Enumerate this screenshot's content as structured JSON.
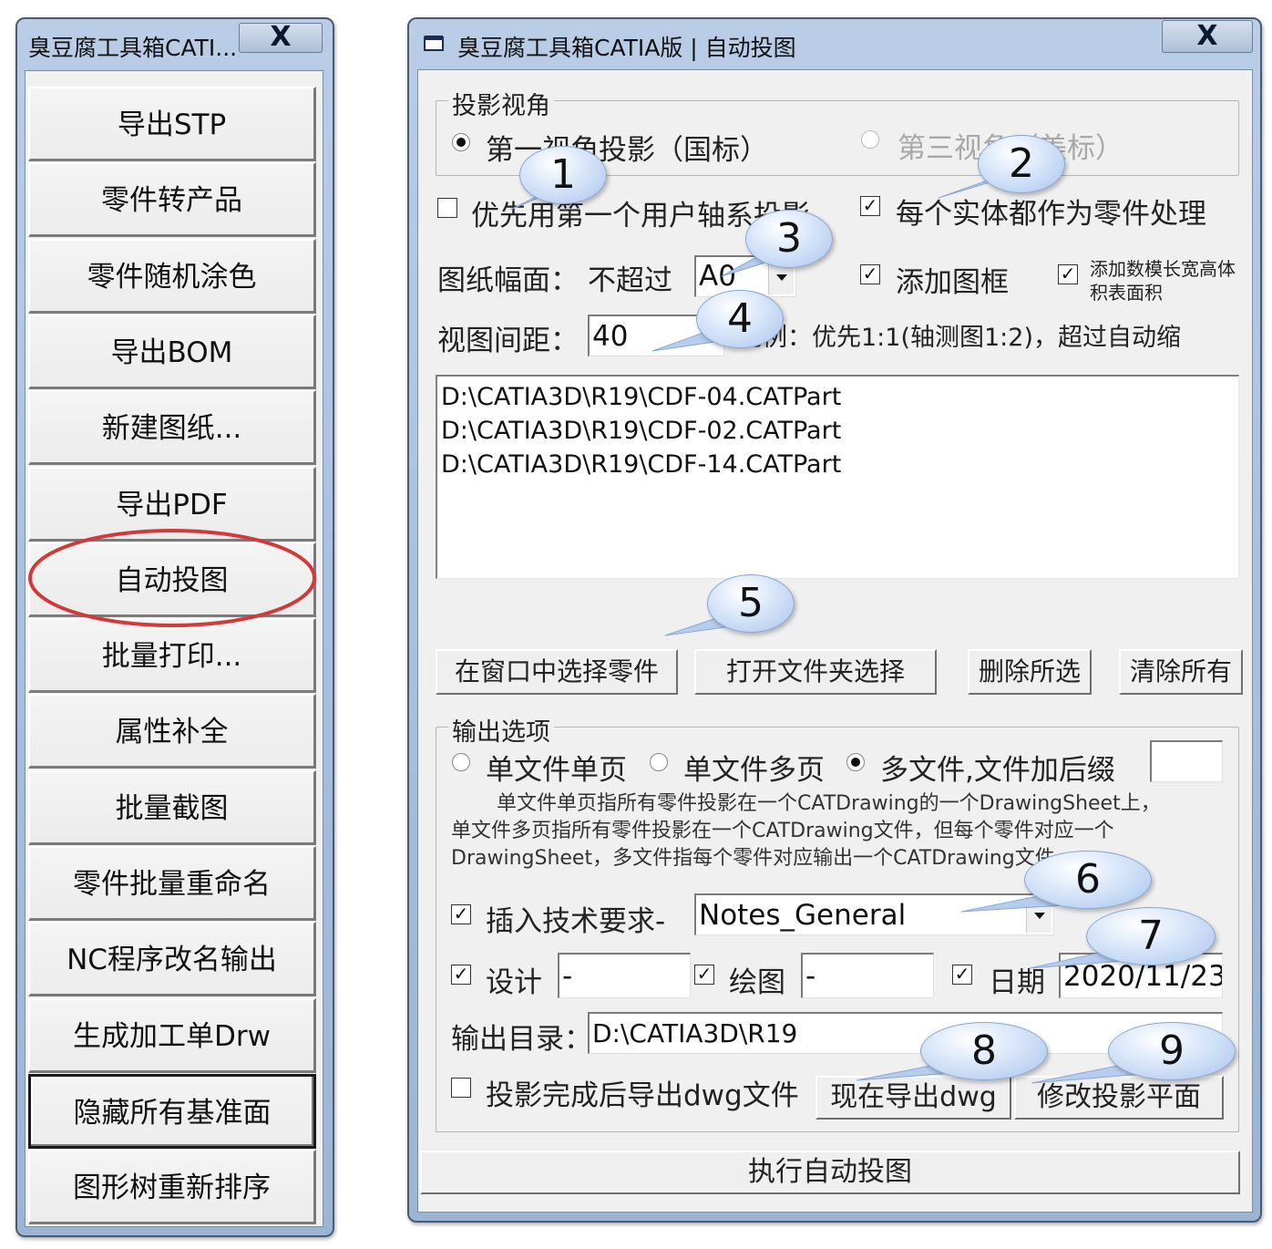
{
  "left_window": {
    "title": "臭豆腐工具箱CATI...",
    "close_label": "X",
    "buttons": [
      {
        "label": "导出STP"
      },
      {
        "label": "零件转产品"
      },
      {
        "label": "零件随机涂色"
      },
      {
        "label": "导出BOM"
      },
      {
        "label": "新建图纸..."
      },
      {
        "label": "导出PDF"
      },
      {
        "label": "自动投图",
        "highlighted": true
      },
      {
        "label": "批量打印..."
      },
      {
        "label": "属性补全"
      },
      {
        "label": "批量截图"
      },
      {
        "label": "零件批量重命名"
      },
      {
        "label": "NC程序改名输出"
      },
      {
        "label": "生成加工单Drw"
      },
      {
        "label": "隐藏所有基准面",
        "default": true
      },
      {
        "label": "图形树重新排序"
      }
    ],
    "highlight_color": "#d23a3a"
  },
  "main_window": {
    "title": "臭豆腐工具箱CATIA版 | 自动投图",
    "close_label": "X",
    "projection": {
      "group_label": "投影视角",
      "first_angle": {
        "label": "第一视角投影（国标）",
        "selected": true
      },
      "third_angle": {
        "label": "第三视角（美标）",
        "selected": false,
        "disabled": true
      }
    },
    "options": {
      "use_first_axis": {
        "label": "优先用第一个用户轴系投影",
        "checked": false
      },
      "each_body_as_part": {
        "label": "每个实体都作为零件处理",
        "checked": true
      }
    },
    "paper": {
      "label": "图纸幅面：",
      "not_exceed": "不超过",
      "size_value": "A0",
      "add_frame": {
        "label": "添加图框",
        "checked": true
      },
      "add_dims": {
        "label_line1": "添加数模长宽高体",
        "label_line2": "积表面积",
        "checked": true
      }
    },
    "spacing": {
      "label": "视图间距：",
      "value": "40",
      "scale_text": "比例：优先1:1(轴测图1:2)，超过自动缩"
    },
    "files": [
      "D:\\CATIA3D\\R19\\CDF-04.CATPart",
      "D:\\CATIA3D\\R19\\CDF-02.CATPart",
      "D:\\CATIA3D\\R19\\CDF-14.CATPart"
    ],
    "file_buttons": {
      "select_in_window": "在窗口中选择零件",
      "open_folder": "打开文件夹选择",
      "delete_selected": "删除所选",
      "clear_all": "清除所有"
    },
    "output": {
      "group_label": "输出选项",
      "single_file_single_page": {
        "label": "单文件单页",
        "selected": false
      },
      "single_file_multi_page": {
        "label": "单文件多页",
        "selected": false
      },
      "multi_file_suffix": {
        "label": "多文件,文件加后缀",
        "selected": true
      },
      "suffix_value": "",
      "desc_line1": "单文件单页指所有零件投影在一个CATDrawing的一个DrawingSheet上，",
      "desc_line2": "单文件多页指所有零件投影在一个CATDrawing文件，但每个零件对应一个",
      "desc_line3": "DrawingSheet，多文件指每个零件对应输出一个CATDrawing文件",
      "insert_notes": {
        "label": "插入技术要求-",
        "checked": true,
        "value": "Notes_General"
      },
      "design": {
        "label": "设计",
        "checked": true,
        "value": "-"
      },
      "drawing": {
        "label": "绘图",
        "checked": true,
        "value": "-"
      },
      "date": {
        "label": "日期",
        "checked": true,
        "value": "2020/11/23"
      },
      "output_dir_label": "输出目录：",
      "output_dir_value": "D:\\CATIA3D\\R19",
      "export_dwg_after": {
        "label": "投影完成后导出dwg文件",
        "checked": false
      },
      "export_dwg_now": "现在导出dwg",
      "modify_plane": "修改投影平面"
    },
    "execute_label": "执行自动投图"
  },
  "callouts": [
    "1",
    "2",
    "3",
    "4",
    "5",
    "6",
    "7",
    "8",
    "9"
  ],
  "check_mark": "✓",
  "colors": {
    "titlebar": "#a6bedc",
    "client_bg": "#f0f0f0",
    "callout_fill": "#c9dbf5",
    "highlight_ring": "#d23a3a"
  }
}
